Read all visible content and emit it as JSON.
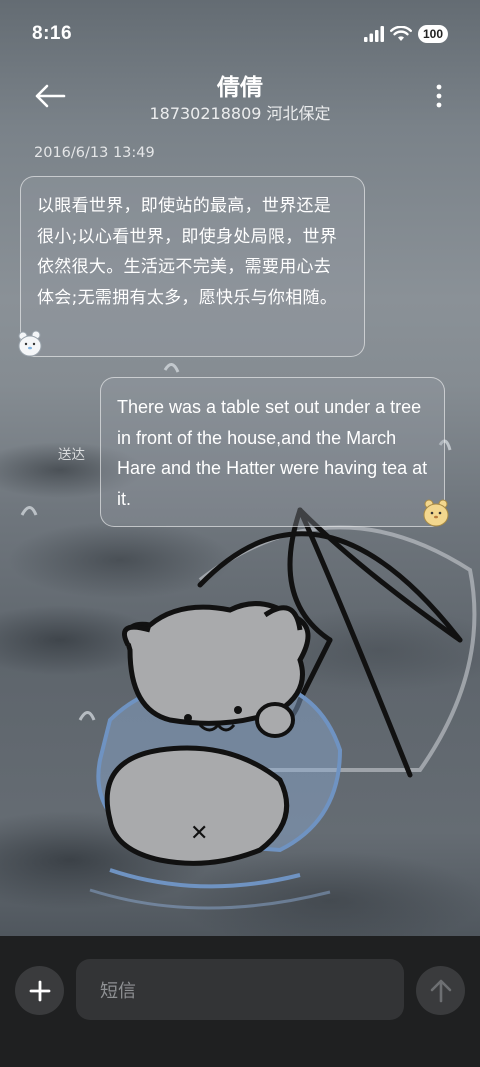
{
  "status_bar": {
    "time": "8:16",
    "battery": "100",
    "icons": [
      "signal-icon",
      "wifi-icon",
      "battery-icon"
    ]
  },
  "header": {
    "contact_name": "倩倩",
    "contact_subtitle": "18730218809 河北保定",
    "back_icon": "arrow-left-icon",
    "menu_icon": "more-vertical-icon"
  },
  "conversation": {
    "timestamp": "2016/6/13 13:49",
    "messages": [
      {
        "direction": "incoming",
        "text": "以眼看世界，即使站的最高，世界还是很小;以心看世界，即使身处局限，世界依然很大。生活远不完美，需要用心去体会;无需拥有太多，愿快乐与你相随。"
      },
      {
        "direction": "outgoing",
        "text": "There was a table set out under a tree in front of the house,and the March Hare and the Hatter were having tea at it.",
        "status": "送达"
      }
    ]
  },
  "composer": {
    "placeholder": "短信",
    "add_icon": "plus-icon",
    "send_icon": "arrow-up-icon"
  },
  "colors": {
    "bottom_bar": "#1f2021",
    "input_bg": "#333436",
    "button_bg": "#3a3b3d",
    "bubble_border": "#ffffff"
  }
}
